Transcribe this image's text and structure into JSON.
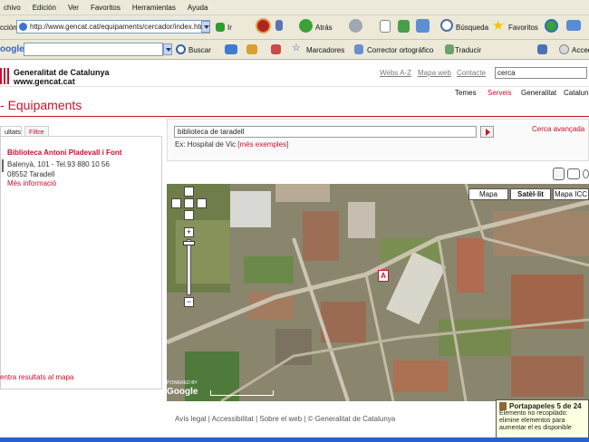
{
  "browser": {
    "menu": [
      "chivo",
      "Edición",
      "Ver",
      "Favoritos",
      "Herramientas",
      "Ayuda"
    ],
    "address_label": "cción",
    "url": "http://www.gencat.cat/equipaments/cercador/index.htm",
    "go_label": "Ir",
    "back_label": "Atrás",
    "search_label": "Búsqueda",
    "favorites_label": "Favoritos",
    "google_logo": "oogle",
    "google_search_label": "Buscar",
    "bookmarks_label": "Marcadores",
    "spell_label": "Corrector ortográfico",
    "translate_label": "Traducir",
    "access_label": "Acced"
  },
  "site": {
    "logo_line1": "Generalitat de Catalunya",
    "logo_line2": "www.gencat.cat",
    "top_links": [
      "Webs A-Z",
      "Mapa web",
      "Contacte"
    ],
    "search_value": "cerca",
    "nav": [
      "Temes",
      "Serveis",
      "Generalitat",
      "Catalun"
    ],
    "section_title": "Equipaments"
  },
  "tabs": {
    "results": "ultats",
    "filter": "Filtre"
  },
  "result": {
    "name": "Biblioteca Antoni Pladevall i Font",
    "address": "Balenyà, 101 - Tel.93 880 10 56",
    "postal": "08552 Taradell",
    "more": "Més informació",
    "center_link": "entra resultats al mapa"
  },
  "search": {
    "value": "biblioteca de taradell",
    "advanced": "Cerca avançada",
    "example_prefix": "Ex: Hospital de Vic",
    "example_link": "[més exemples]"
  },
  "map": {
    "buttons": [
      "Mapa",
      "Satèl·lit",
      "Mapa ICC"
    ],
    "active": "Satèl·lit",
    "marker": "A",
    "powered": "POWERED BY",
    "google": "Google"
  },
  "footer": "Avís legal | Accessibilitat | Sobre el web | © Generalitat de Catalunya",
  "clipboard": {
    "title": "Portapapeles 5 de 24",
    "message": "Elemento no recopilado: elimine elementos para aumentar el es disponible"
  }
}
